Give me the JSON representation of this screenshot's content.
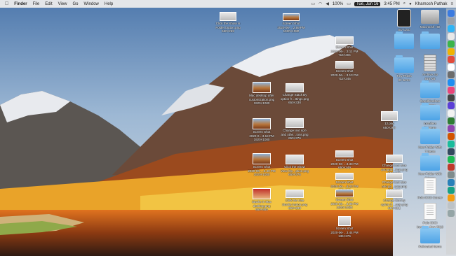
{
  "menubar": {
    "apple": "",
    "items": [
      "Finder",
      "File",
      "Edit",
      "View",
      "Go",
      "Window",
      "Help"
    ],
    "battery": "100%",
    "date": "Tue, Jun 16",
    "time": "3:45 PM",
    "user": "Khamosh Pathak"
  },
  "icons": [
    {
      "label": "Click the Show in\nFolder button.png\n650×268"
    },
    {
      "label": "Screen Shot\n2020-06-…2.59 PM\n1920×1080"
    },
    {
      "label": "Screen Shot\n2020-06-…3.11 PM\n716×304"
    },
    {
      "label": "Screen Shot\n2020-06-…3.13 PM\n712×245"
    },
    {
      "label": "Mac desktop after\ncustomization.png\n1920×1080"
    },
    {
      "label": "Change Stack By\noption fr…ttings.png\n650×338"
    },
    {
      "label": "Screen Shot\n2020-0…3.18 PM\n1920×1080"
    },
    {
      "label": "Change text size\nand othe…ions.png\n650×376"
    },
    {
      "label": "12.png\n650×368"
    },
    {
      "label": "Screen Shot\n2020-06-…3.40 PM\n1920×1080"
    },
    {
      "label": "Click the Show\nView Op…ption.png\n650×376"
    },
    {
      "label": "Screen Shot\n2020-06-…3.33 PM\n650×349"
    },
    {
      "label": "Change icon size\nand grid…ings.png\n650×360"
    },
    {
      "label": "Screen Shot\n2020-06-…5.22 PM\n338×305"
    },
    {
      "label": "Change icon size\nand gri…stop.png\n650×364"
    },
    {
      "label": "Stacks in Mac\ndesktop.png\n650×384"
    },
    {
      "label": "Click the Use\nStacks button.png\n650×239"
    },
    {
      "label": "Screen Shot\n2020-06-…3.36 PM\n1920×1080"
    },
    {
      "label": "Change Sort by\noption fr…stop.png\n650×391"
    },
    {
      "label": "Screen Shot\n2020-06-…3.44 PM\n136×276"
    },
    {
      "label": "SD Card"
    },
    {
      "label": "Macintosh HD"
    },
    {
      "label": "Tiny PNGs\n33 items"
    },
    {
      "label": "Archive.zip\n616 KB"
    },
    {
      "label": "Gandhinathan\n4 items"
    },
    {
      "label": "Installers\n24 items"
    },
    {
      "label": "New Folder With\n7 items"
    },
    {
      "label": "New Folder With\n2 items"
    },
    {
      "label": "Polo ICICI Career"
    },
    {
      "label": "Polo ICICI\ninvoice…Nov 2019"
    },
    {
      "label": "Relocated Items"
    }
  ]
}
